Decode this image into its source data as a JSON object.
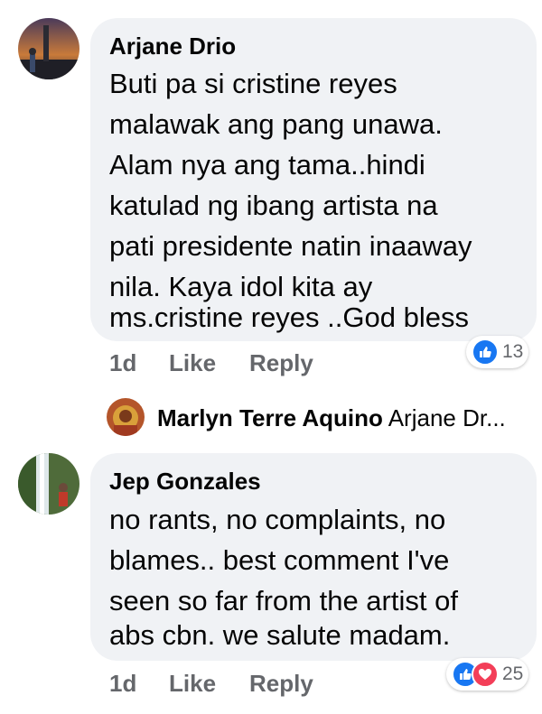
{
  "comments": [
    {
      "author": "Arjane Drio",
      "lines": [
        "Buti pa si cristine reyes",
        "malawak ang pang unawa.",
        "Alam nya ang tama..hindi",
        "katulad ng ibang artista na",
        "pati presidente natin inaaway",
        "nila. Kaya idol kita ay",
        "ms.cristine reyes ..God bless"
      ],
      "time": "1d",
      "like_label": "Like",
      "reply_label": "Reply",
      "reaction_count": "13",
      "reaction_icons": [
        "like-icon"
      ]
    },
    {
      "author": "Jep Gonzales",
      "lines": [
        "no rants, no complaints, no",
        "blames.. best comment I've",
        "seen so far from the artist of",
        "abs cbn. we salute madam."
      ],
      "time": "1d",
      "like_label": "Like",
      "reply_label": "Reply",
      "reaction_count": "25",
      "reaction_icons": [
        "like-icon",
        "love-icon"
      ]
    }
  ],
  "reply_preview": {
    "author": "Marlyn Terre Aquino",
    "text": "Arjane Dr..."
  },
  "colors": {
    "bubble": "#f0f2f5",
    "meta": "#65676b",
    "like_blue": "#1877f2",
    "love_red": "#f33e58"
  }
}
